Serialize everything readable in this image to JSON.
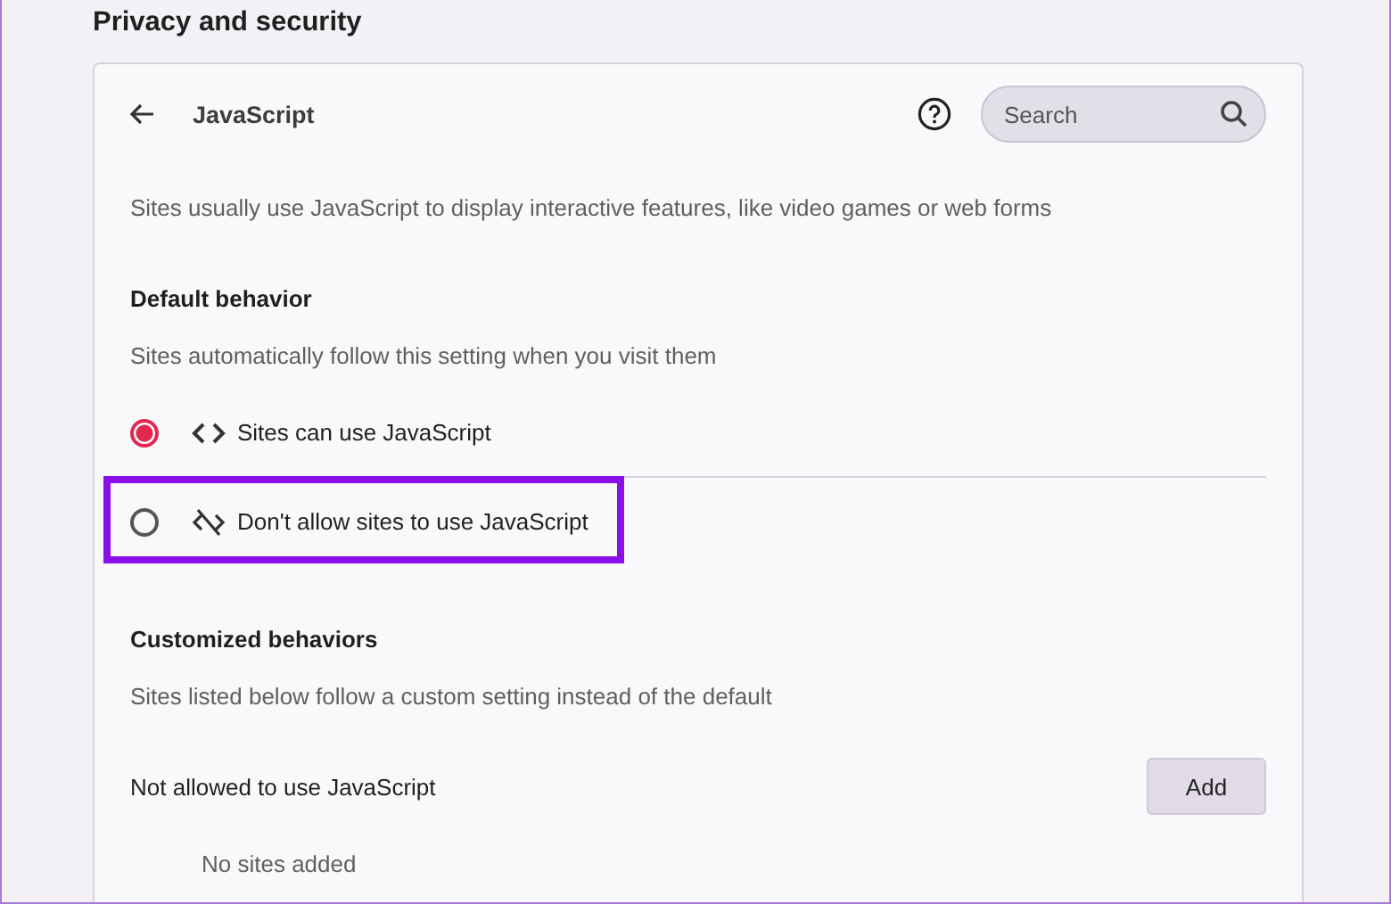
{
  "section_title": "Privacy and security",
  "page": {
    "title": "JavaScript",
    "search": {
      "placeholder": "Search"
    },
    "description": "Sites usually use JavaScript to display interactive features, like video games or web forms"
  },
  "default_behavior": {
    "heading": "Default behavior",
    "description": "Sites automatically follow this setting when you visit them",
    "options": [
      {
        "label": "Sites can use JavaScript",
        "kind": "code",
        "selected": true,
        "highlighted": false
      },
      {
        "label": "Don't allow sites to use JavaScript",
        "kind": "code-off",
        "selected": false,
        "highlighted": true
      }
    ]
  },
  "customized_behaviors": {
    "heading": "Customized behaviors",
    "description": "Sites listed below follow a custom setting instead of the default",
    "lists": [
      {
        "title": "Not allowed to use JavaScript",
        "button": "Add",
        "empty_text": "No sites added"
      }
    ]
  }
}
